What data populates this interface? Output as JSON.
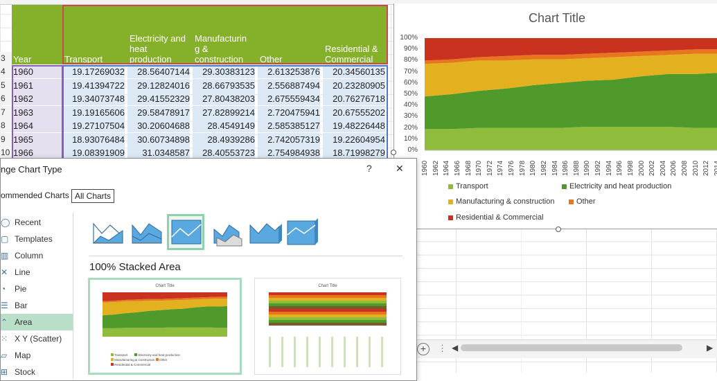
{
  "sheet": {
    "row_numbers": [
      "3",
      "4",
      "5",
      "6",
      "7",
      "8",
      "9",
      "10"
    ],
    "headers": [
      "Year",
      "Transport",
      "Electricity and\nheat\nproduction",
      "Manufacturin\ng &\nconstruction",
      "Other",
      "Residential &\nCommercial"
    ],
    "rows": [
      [
        "1960",
        "19.17269032",
        "28.56407144",
        "29.30383123",
        "2.613253876",
        "20.34560135"
      ],
      [
        "1961",
        "19.41394722",
        "29.12824016",
        "28.66793535",
        "2.556887494",
        "20.23280905"
      ],
      [
        "1962",
        "19.34073748",
        "29.41552329",
        "27.80438203",
        "2.675559434",
        "20.76276718"
      ],
      [
        "1963",
        "19.19165606",
        "29.58478917",
        "27.82899214",
        "2.720475941",
        "20.67555202"
      ],
      [
        "1964",
        "19.27107504",
        "30.20604688",
        "28.4549149",
        "2.585385127",
        "19.48226448"
      ],
      [
        "1965",
        "18.93076484",
        "30.60734898",
        "28.4939286",
        "2.742057319",
        "19.22604954"
      ],
      [
        "1966",
        "19.08391909",
        "31.0348587",
        "28.40553723",
        "2.754984938",
        "18.71998279"
      ]
    ],
    "colors": {
      "header_bg": "#84b02a",
      "year_bg": "#e6dff0",
      "num_bg": "#dce9f5"
    }
  },
  "chart": {
    "title": "Chart Title",
    "y_ticks": [
      "100%",
      "90%",
      "80%",
      "70%",
      "60%",
      "50%",
      "40%",
      "30%",
      "20%",
      "10%",
      "0%"
    ],
    "x_ticks": [
      "1960",
      "1962",
      "1964",
      "1966",
      "1968",
      "1970",
      "1972",
      "1974",
      "1976",
      "1978",
      "1980",
      "1982",
      "1984",
      "1986",
      "1988",
      "1990",
      "1992",
      "1994",
      "1996",
      "1998",
      "2000",
      "2002",
      "2004",
      "2006",
      "2008",
      "2010",
      "2012",
      "2014"
    ],
    "legend": [
      {
        "label": "Transport",
        "color": "#8fbc3a"
      },
      {
        "label": "Electricity and heat production",
        "color": "#4f9a2a"
      },
      {
        "label": "Manufacturing  & construction",
        "color": "#e3b020"
      },
      {
        "label": "Other",
        "color": "#e8761c"
      },
      {
        "label": "Residential & Commercial",
        "color": "#c8321e"
      }
    ]
  },
  "chart_data": {
    "type": "area",
    "title": "Chart Title",
    "stacking": "100%",
    "x": [
      1960,
      1965,
      1970,
      1975,
      1980,
      1985,
      1990,
      1995,
      2000,
      2005,
      2010,
      2014
    ],
    "series": [
      {
        "name": "Transport",
        "values": [
          19,
          19,
          20,
          20,
          20,
          20,
          21,
          21,
          21,
          21,
          20,
          20
        ]
      },
      {
        "name": "Electricity and heat production",
        "values": [
          29,
          31,
          33,
          35,
          38,
          40,
          41,
          42,
          45,
          47,
          48,
          49
        ]
      },
      {
        "name": "Manufacturing  & construction",
        "values": [
          29,
          28,
          27,
          25,
          23,
          21,
          20,
          20,
          18,
          17,
          18,
          17
        ]
      },
      {
        "name": "Other",
        "values": [
          3,
          3,
          3,
          4,
          4,
          4,
          4,
          4,
          4,
          4,
          4,
          4
        ]
      },
      {
        "name": "Residential & Commercial",
        "values": [
          20,
          19,
          17,
          16,
          15,
          15,
          14,
          13,
          12,
          11,
          10,
          10
        ]
      }
    ],
    "ylim": [
      0,
      100
    ],
    "legend_position": "bottom"
  },
  "dialog": {
    "title": "nge Chart Type",
    "help": "?",
    "close": "✕",
    "tabs": [
      "ommended Charts",
      "All Charts"
    ],
    "nav": [
      {
        "label": "Recent",
        "icon": "clock-icon"
      },
      {
        "label": "Templates",
        "icon": "folder-icon"
      },
      {
        "label": "Column",
        "icon": "column-chart-icon"
      },
      {
        "label": "Line",
        "icon": "line-chart-icon"
      },
      {
        "label": "Pie",
        "icon": "pie-chart-icon"
      },
      {
        "label": "Bar",
        "icon": "bar-chart-icon"
      },
      {
        "label": "Area",
        "icon": "area-chart-icon"
      },
      {
        "label": "X Y (Scatter)",
        "icon": "scatter-chart-icon"
      },
      {
        "label": "Map",
        "icon": "map-chart-icon"
      },
      {
        "label": "Stock",
        "icon": "stock-chart-icon"
      }
    ],
    "selected_nav": "Area",
    "section_title": "100% Stacked Area",
    "preview_title": "Chart Title"
  },
  "colors": {
    "accent_green": "#8fd1ad",
    "nav_selected": "#b9dfc9"
  }
}
